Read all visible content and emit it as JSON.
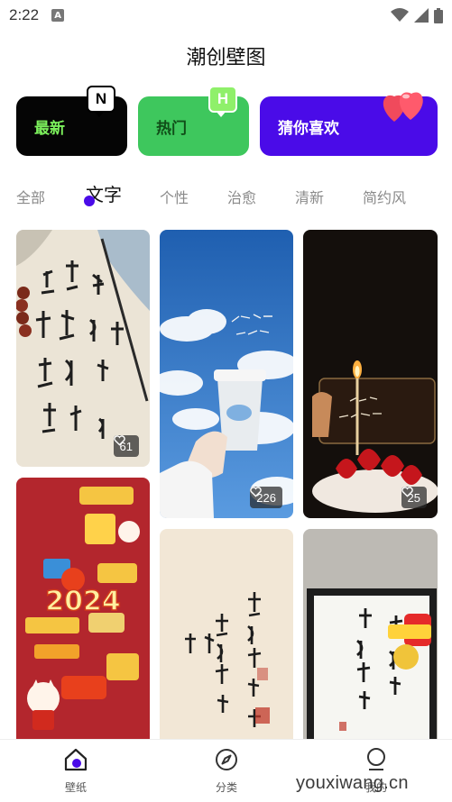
{
  "status_bar": {
    "time": "2:22",
    "app_icon_letter": "A"
  },
  "header": {
    "title": "潮创壁图"
  },
  "feature_cards": [
    {
      "label": "最新",
      "badge": "N",
      "color": "#050505"
    },
    {
      "label": "热门",
      "badge": "H",
      "color": "#3ec75d"
    },
    {
      "label": "猜你喜欢",
      "badge_icon": "hearts-icon",
      "color": "#4a0be8"
    }
  ],
  "tabs": {
    "all": "全部",
    "text": "文字",
    "personality": "个性",
    "healing": "治愈",
    "fresh": "清新",
    "minimal": "简约风"
  },
  "grid": {
    "tiles": [
      {
        "theme": "calligraphy-poem",
        "likes": "61"
      },
      {
        "theme": "sky-coffee-cup",
        "likes": "226"
      },
      {
        "theme": "birthday-cake-candle",
        "likes": "25"
      },
      {
        "theme": "new-year-2024-poster",
        "poster_year": "2024"
      },
      {
        "theme": "calligraphy-scroll"
      },
      {
        "theme": "framed-calligraphy-redpacket"
      }
    ]
  },
  "bottom_nav": {
    "wallpaper": "壁纸",
    "category": "分类",
    "mine": "我的"
  },
  "watermark": "youxiwang.cn",
  "colors": {
    "accent": "#4a0be8",
    "green": "#3ec75d",
    "neon": "#7cf05c"
  }
}
